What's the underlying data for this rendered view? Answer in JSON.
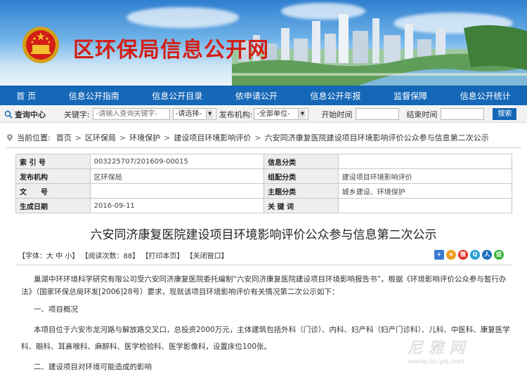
{
  "site": {
    "title": "区环保局信息公开网",
    "emblem": "national-emblem-icon"
  },
  "nav": {
    "items": [
      {
        "label": "首 页"
      },
      {
        "label": "信息公开指南"
      },
      {
        "label": "信息公开目录"
      },
      {
        "label": "依申请公开"
      },
      {
        "label": "信息公开年报"
      },
      {
        "label": "监督保障"
      },
      {
        "label": "信息公开统计"
      }
    ]
  },
  "search": {
    "center_label": "查询中心",
    "keyword_label": "关键字:",
    "keyword_placeholder": "-请输入查询关键字-",
    "select_value": "-请选择-",
    "org_label": "发布机构:",
    "org_value": "-全部单位-",
    "start_label": "开始时间",
    "end_label": "结束时间",
    "button_label": "搜索"
  },
  "breadcrumb": {
    "prefix": "当前位置:",
    "items": [
      "首页",
      "区环保局",
      "环境保护",
      "建设项目环境影响评价",
      "六安同济康复医院建设项目环境影响评价公众参与信息第二次公示"
    ],
    "separator": ">"
  },
  "info": {
    "rows": [
      {
        "k1": "索 引 号",
        "v1": "003225707/201609-00015",
        "k2": "信息分类",
        "v2": ""
      },
      {
        "k1": "发布机构",
        "v1": "区环保局",
        "k2": "组配分类",
        "v2": "建设项目环境影响评价"
      },
      {
        "k1": "文　　号",
        "v1": "",
        "k2": "主题分类",
        "v2": "城乡建设、环境保护"
      },
      {
        "k1": "生成日期",
        "v1": "2016-09-11",
        "k2": "关 键 词",
        "v2": ""
      }
    ]
  },
  "article": {
    "title": "六安同济康复医院建设项目环境影响评价公众参与信息第二次公示",
    "tools": {
      "font": "【字体：大 中 小】",
      "views": "【阅读次数：88】",
      "print": "【打印本页】",
      "close": "【关闭窗口】"
    },
    "share_icons": [
      "plus-share-icon",
      "star-icon",
      "weibo-icon",
      "tencent-icon",
      "renren-icon",
      "wechat-icon"
    ],
    "paragraphs": [
      "巢湖中环环境科学研究有限公司受六安同济康复医院委托编制“六安同济康复医院建设项目环境影响报告书”，根据《环境影响评价公众参与暂行办",
      "法》（国家环保总局环发[2006]28号）要求，现就该项目环境影响评价有关情况第二次公示如下：",
      "一、项目概况",
      "本项目位于六安市龙河路与解放路交叉口，总投资2000万元，主体建筑包括外科（门诊）、内科、妇产科（妇产门诊科）、儿科、中医科、康复医学",
      "科、眼科、耳鼻喉科、麻醉科、医学检验科、医学影像科，设置床位100张。",
      "二、建设项目对环境可能造成的影响"
    ]
  },
  "watermark": {
    "line1": "尼 雅 网",
    "line2": "www.lx-yo.net"
  },
  "colors": {
    "nav_bg": "#1568b8",
    "title_red": "#d31f16"
  }
}
